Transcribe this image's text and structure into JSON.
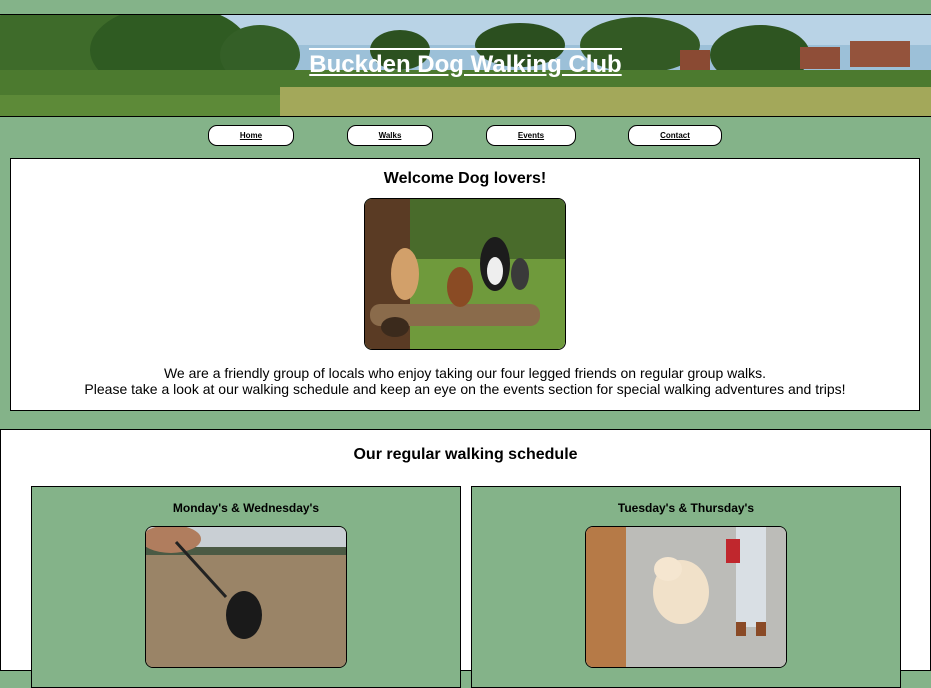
{
  "header": {
    "title": "Buckden Dog Walking Club"
  },
  "nav": {
    "items": [
      "Home",
      "Walks",
      "Events",
      "Contact"
    ]
  },
  "welcome": {
    "heading": "Welcome Dog lovers!",
    "line1": "We are a friendly group of locals who enjoy taking our four legged friends on regular group walks.",
    "line2": "Please take a look at our walking schedule and keep an eye on the events section for special walking adventures and trips!"
  },
  "schedule": {
    "heading": "Our regular walking schedule",
    "cards": [
      {
        "day": "Monday's & Wednesday's"
      },
      {
        "day": "Tuesday's & Thursday's"
      }
    ]
  }
}
